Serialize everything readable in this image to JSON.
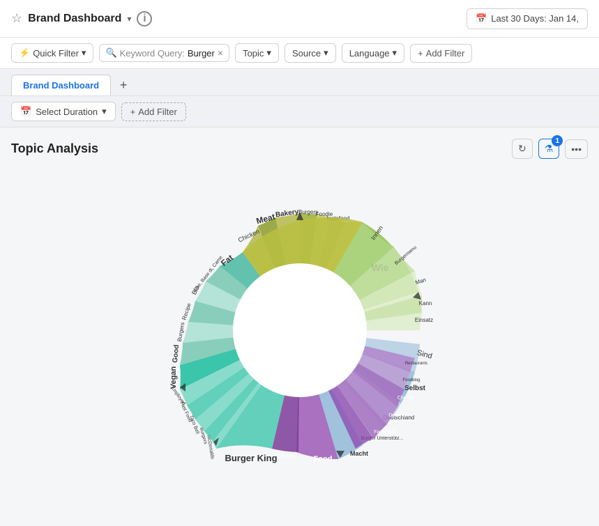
{
  "topbar": {
    "title": "Brand Dashboard",
    "chevron": "▾",
    "info": "i",
    "star": "☆",
    "date_icon": "📅",
    "date_label": "Last 30 Days: Jan 14,"
  },
  "filterbar": {
    "quick_filter": "Quick Filter",
    "keyword_label": "Keyword Query:",
    "keyword_value": "Burger",
    "topic": "Topic",
    "source": "Source",
    "language": "Language",
    "add_filter": "+ Add Filter"
  },
  "tabs": {
    "active": "Brand Dashboard",
    "add": "+"
  },
  "duration": {
    "label": "Select Duration",
    "add_filter": "+ Add Filter"
  },
  "section": {
    "title": "Topic Analysis",
    "refresh": "↻",
    "filter_badge": "1",
    "more": "•••"
  }
}
